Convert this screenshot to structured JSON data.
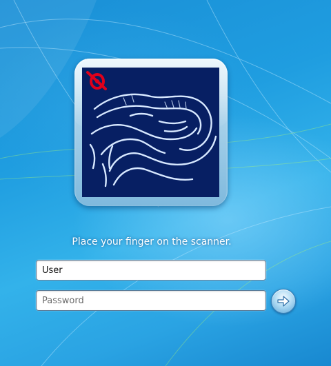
{
  "login": {
    "prompt": "Place your finger on the scanner.",
    "username_value": "User",
    "password_placeholder": "Password"
  },
  "colors": {
    "background": "#1f9de0",
    "tile_picture": "#071f63",
    "badge": "#e0001b"
  },
  "icons": {
    "tile": "fingerprint-scanner-icon",
    "badge": "scanner-brand-badge-icon",
    "submit": "arrow-right-icon"
  }
}
